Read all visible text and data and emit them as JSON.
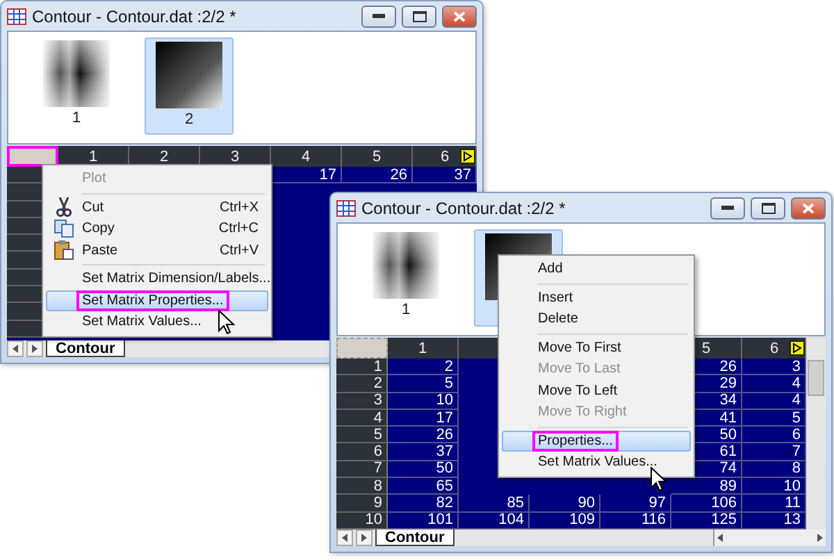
{
  "windows": [
    {
      "title": "Contour - Contour.dat :2/2 *",
      "thumbnails": [
        {
          "label": "1",
          "selected": false
        },
        {
          "label": "2",
          "selected": true
        }
      ],
      "corner_outlined": true,
      "columns": [
        "1",
        "2",
        "3",
        "4",
        "5",
        "6"
      ],
      "scrollbars": false,
      "rows": [
        {
          "cells": [
            null,
            null,
            null,
            "17",
            "26",
            "37"
          ]
        },
        {
          "cells": []
        },
        {
          "cells": []
        },
        {
          "cells": []
        },
        {
          "cells": []
        },
        {
          "cells": []
        },
        {
          "cells": []
        },
        {
          "cells": []
        },
        {
          "cells": []
        },
        {
          "cells": []
        }
      ],
      "sheet_tab": "Contour"
    },
    {
      "title": "Contour - Contour.dat :2/2 *",
      "thumbnails": [
        {
          "label": "1",
          "selected": false
        },
        {
          "selected": true
        }
      ],
      "corner_outlined": false,
      "columns": [
        "1",
        null,
        null,
        null,
        "5",
        "6"
      ],
      "scrollbars": true,
      "rows": [
        {
          "header": "1",
          "cells": [
            "2",
            null,
            null,
            null,
            "26",
            "3"
          ]
        },
        {
          "header": "2",
          "cells": [
            "5",
            null,
            null,
            null,
            "29",
            "4"
          ]
        },
        {
          "header": "3",
          "cells": [
            "10",
            null,
            null,
            null,
            "34",
            "4"
          ]
        },
        {
          "header": "4",
          "cells": [
            "17",
            null,
            null,
            null,
            "41",
            "5"
          ]
        },
        {
          "header": "5",
          "cells": [
            "26",
            null,
            null,
            null,
            "50",
            "6"
          ]
        },
        {
          "header": "6",
          "cells": [
            "37",
            null,
            null,
            null,
            "61",
            "7"
          ]
        },
        {
          "header": "7",
          "cells": [
            "50",
            null,
            null,
            null,
            "74",
            "8"
          ]
        },
        {
          "header": "8",
          "cells": [
            "65",
            null,
            null,
            null,
            "89",
            "10"
          ]
        },
        {
          "header": "9",
          "cells": [
            "82",
            "85",
            "90",
            "97",
            "106",
            "11"
          ]
        },
        {
          "header": "10",
          "cells": [
            "101",
            "104",
            "109",
            "116",
            "125",
            "13"
          ]
        }
      ],
      "sheet_tab": "Contour"
    }
  ],
  "menus": [
    {
      "items": [
        {
          "kind": "plain",
          "label": "Plot",
          "disabled": true,
          "highlighted": false,
          "outlined": false
        },
        {
          "kind": "separator"
        },
        {
          "kind": "cut",
          "label": "Cut",
          "shortcut": "Ctrl+X",
          "disabled": false,
          "highlighted": false,
          "outlined": false
        },
        {
          "kind": "copy",
          "label": "Copy",
          "shortcut": "Ctrl+C",
          "disabled": false,
          "highlighted": false,
          "outlined": false
        },
        {
          "kind": "paste",
          "label": "Paste",
          "shortcut": "Ctrl+V",
          "disabled": false,
          "highlighted": false,
          "outlined": false
        },
        {
          "kind": "separator"
        },
        {
          "kind": "plain",
          "label": "Set Matrix Dimension/Labels...",
          "disabled": false,
          "highlighted": false,
          "outlined": false
        },
        {
          "kind": "plain",
          "label": "Set Matrix Properties...",
          "disabled": false,
          "highlighted": true,
          "outlined": true
        },
        {
          "kind": "plain",
          "label": "Set Matrix Values...",
          "disabled": false,
          "highlighted": false,
          "outlined": false
        }
      ]
    },
    {
      "items": [
        {
          "kind": "plain",
          "label": "Add",
          "disabled": false,
          "highlighted": false,
          "outlined": false
        },
        {
          "kind": "separator"
        },
        {
          "kind": "plain",
          "label": "Insert",
          "disabled": false,
          "highlighted": false,
          "outlined": false
        },
        {
          "kind": "plain",
          "label": "Delete",
          "disabled": false,
          "highlighted": false,
          "outlined": false
        },
        {
          "kind": "separator"
        },
        {
          "kind": "plain",
          "label": "Move To First",
          "disabled": false,
          "highlighted": false,
          "outlined": false
        },
        {
          "kind": "plain",
          "label": "Move To Last",
          "disabled": true,
          "highlighted": false,
          "outlined": false
        },
        {
          "kind": "plain",
          "label": "Move To Left",
          "disabled": false,
          "highlighted": false,
          "outlined": false
        },
        {
          "kind": "plain",
          "label": "Move To Right",
          "disabled": true,
          "highlighted": false,
          "outlined": false
        },
        {
          "kind": "separator"
        },
        {
          "kind": "plain",
          "label": "Properties...",
          "disabled": false,
          "highlighted": true,
          "outlined": true
        },
        {
          "kind": "plain",
          "label": "Set Matrix Values...",
          "disabled": false,
          "highlighted": false,
          "outlined": false
        }
      ]
    }
  ]
}
